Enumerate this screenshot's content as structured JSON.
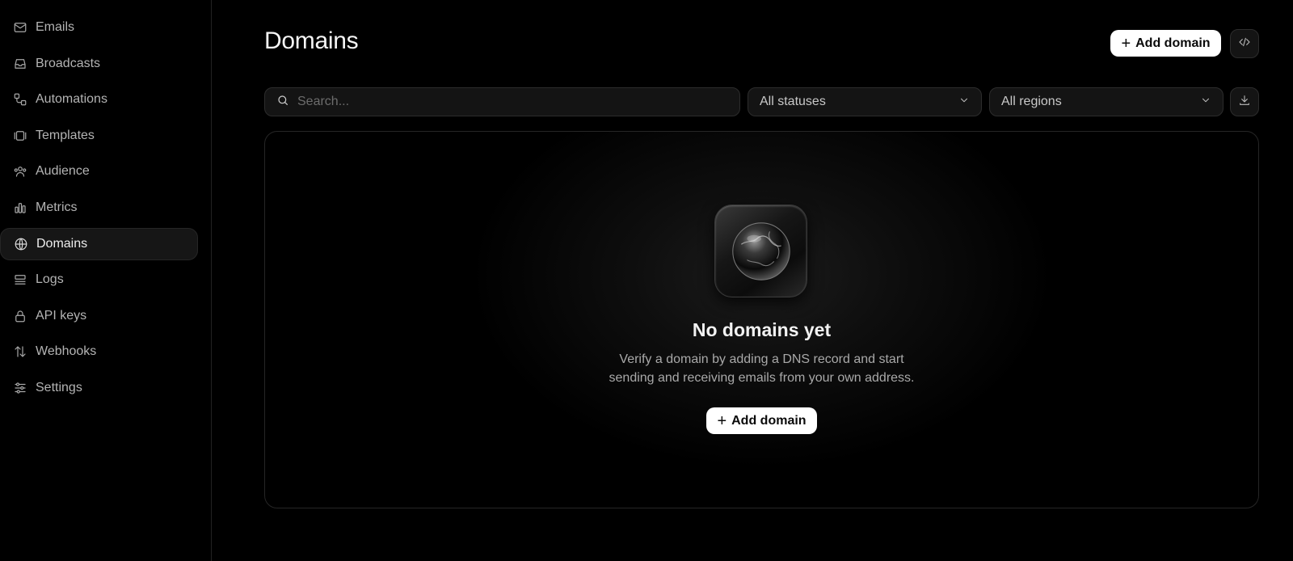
{
  "sidebar": {
    "items": [
      {
        "label": "Emails",
        "icon": "mail-icon"
      },
      {
        "label": "Broadcasts",
        "icon": "inbox-icon"
      },
      {
        "label": "Automations",
        "icon": "workflow-icon"
      },
      {
        "label": "Templates",
        "icon": "templates-icon"
      },
      {
        "label": "Audience",
        "icon": "users-icon"
      },
      {
        "label": "Metrics",
        "icon": "bar-chart-icon"
      },
      {
        "label": "Domains",
        "icon": "globe-icon",
        "active": true
      },
      {
        "label": "Logs",
        "icon": "logs-icon"
      },
      {
        "label": "API keys",
        "icon": "lock-icon"
      },
      {
        "label": "Webhooks",
        "icon": "arrows-icon"
      },
      {
        "label": "Settings",
        "icon": "sliders-icon"
      }
    ]
  },
  "header": {
    "title": "Domains",
    "add_button_label": "Add domain",
    "code_button_icon": "code-icon"
  },
  "filters": {
    "search_placeholder": "Search...",
    "status_value": "All statuses",
    "region_value": "All regions",
    "download_icon": "download-icon"
  },
  "empty_state": {
    "title": "No domains yet",
    "description_line1": "Verify a domain by adding a DNS record and start",
    "description_line2": "sending and receiving emails from your own address.",
    "button_label": "Add domain"
  },
  "colors": {
    "background": "#000000",
    "sidebar_active_bg": "#161616",
    "button_bg": "#ffffff",
    "muted_text": "#a9a9a9"
  }
}
